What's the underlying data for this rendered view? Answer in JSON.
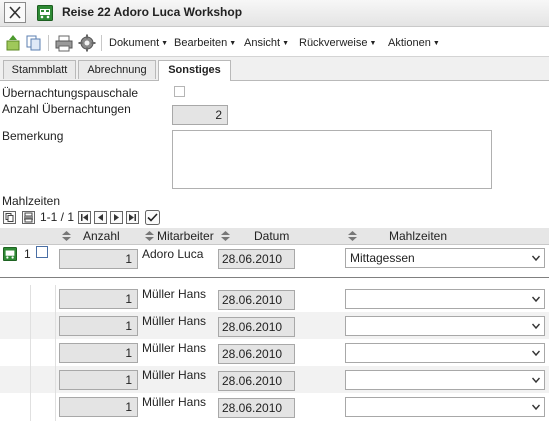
{
  "window": {
    "title": "Reise 22 Adoro Luca Workshop"
  },
  "toolbar": {
    "menus": [
      "Dokument",
      "Bearbeiten",
      "Ansicht",
      "Rückverweise",
      "Aktionen"
    ]
  },
  "tabs": [
    {
      "label": "Stammblatt",
      "active": false
    },
    {
      "label": "Abrechnung",
      "active": false
    },
    {
      "label": "Sonstiges",
      "active": true
    }
  ],
  "form": {
    "uebernachtungspauschale_label": "Übernachtungspauschale",
    "uebernachtungspauschale_checked": false,
    "anzahl_uebernachtungen_label": "Anzahl Übernachtungen",
    "anzahl_uebernachtungen_value": "2",
    "bemerkung_label": "Bemerkung",
    "bemerkung_value": ""
  },
  "mahlzeiten": {
    "section_label": "Mahlzeiten",
    "pager_text": "1-1 / 1",
    "columns": [
      "Anzahl",
      "Mitarbeiter",
      "Datum",
      "Mahlzeiten"
    ],
    "main_row": {
      "index": "1",
      "anzahl": "1",
      "mitarbeiter": "Adoro Luca",
      "datum": "28.06.2010",
      "mahlzeit": "Mittagessen"
    },
    "rows": [
      {
        "anzahl": "1",
        "mitarbeiter": "Müller Hans",
        "datum": "28.06.2010",
        "mahlzeit": ""
      },
      {
        "anzahl": "1",
        "mitarbeiter": "Müller Hans",
        "datum": "28.06.2010",
        "mahlzeit": ""
      },
      {
        "anzahl": "1",
        "mitarbeiter": "Müller Hans",
        "datum": "28.06.2010",
        "mahlzeit": ""
      },
      {
        "anzahl": "1",
        "mitarbeiter": "Müller Hans",
        "datum": "28.06.2010",
        "mahlzeit": ""
      },
      {
        "anzahl": "1",
        "mitarbeiter": "Müller Hans",
        "datum": "28.06.2010",
        "mahlzeit": ""
      }
    ]
  }
}
